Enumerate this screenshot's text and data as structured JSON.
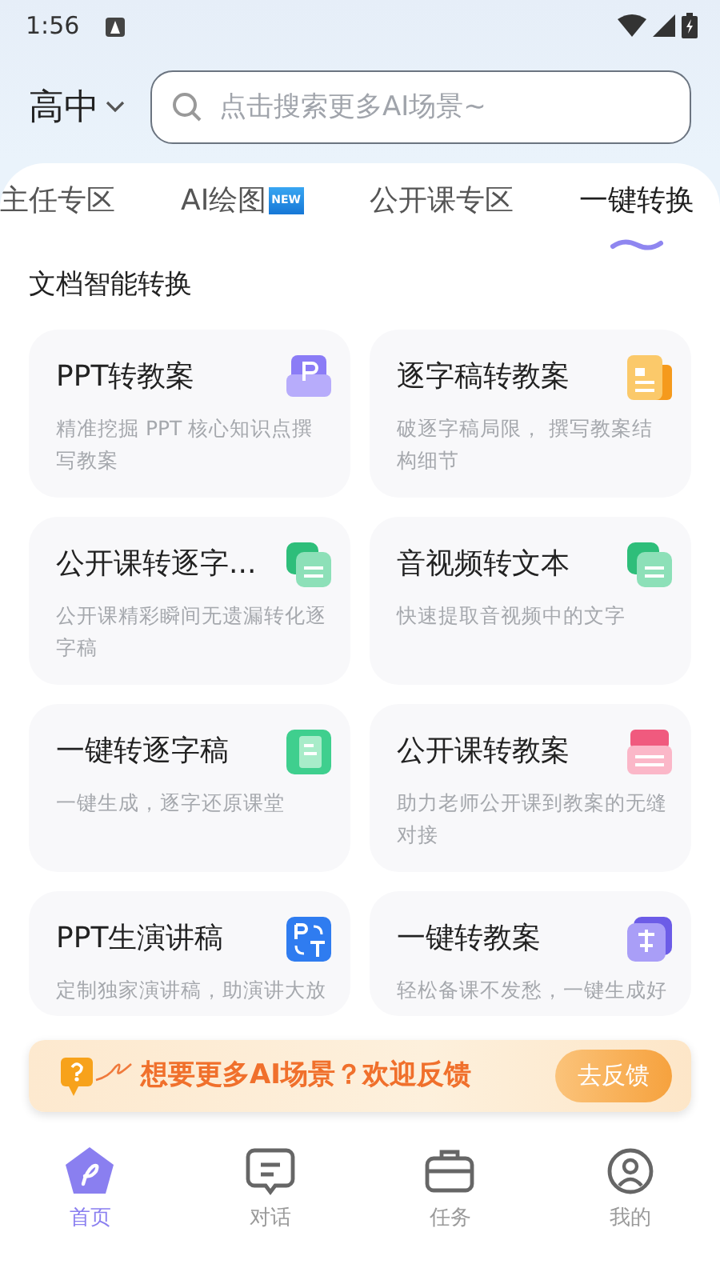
{
  "status_bar": {
    "time": "1:56"
  },
  "header": {
    "grade": "高中",
    "search": {
      "placeholder": "点击搜索更多AI场景~"
    }
  },
  "tabs": [
    {
      "label": "主任专区",
      "selected": false,
      "new": false
    },
    {
      "label": "AI绘图",
      "selected": false,
      "new": true,
      "badge": "NEW"
    },
    {
      "label": "公开课专区",
      "selected": false,
      "new": false
    },
    {
      "label": "一键转换",
      "selected": true,
      "new": false
    }
  ],
  "section_title": "文档智能转换",
  "cards": [
    {
      "title": "PPT转教案",
      "description": "精准挖掘 PPT 核心知识点撰写教案",
      "kind": "ppt"
    },
    {
      "title": "逐字稿转教案",
      "description": "破逐字稿局限， 撰写教案结构细节",
      "kind": "doc"
    },
    {
      "title": "公开课转逐字...",
      "description": "公开课精彩瞬间无遗漏转化逐字稿",
      "kind": "copy"
    },
    {
      "title": "音视频转文本",
      "description": "快速提取音视频中的文字",
      "kind": "copy"
    },
    {
      "title": "一键转逐字稿",
      "description": "一键生成，逐字还原课堂",
      "kind": "note"
    },
    {
      "title": "公开课转教案",
      "description": "助力老师公开课到教案的无缝对接",
      "kind": "tray"
    },
    {
      "title": "PPT生演讲稿",
      "description": "定制独家演讲稿，助演讲大放",
      "kind": "translate"
    },
    {
      "title": "一键转教案",
      "description": "轻松备课不发愁，一键生成好",
      "kind": "convert"
    }
  ],
  "banner": {
    "text": "想要更多AI场景？欢迎反馈",
    "button": "去反馈"
  },
  "bottom_nav": [
    {
      "label": "首页",
      "selected": true,
      "kind": "home"
    },
    {
      "label": "对话",
      "selected": false,
      "kind": "chat"
    },
    {
      "label": "任务",
      "selected": false,
      "kind": "task"
    },
    {
      "label": "我的",
      "selected": false,
      "kind": "me"
    }
  ]
}
